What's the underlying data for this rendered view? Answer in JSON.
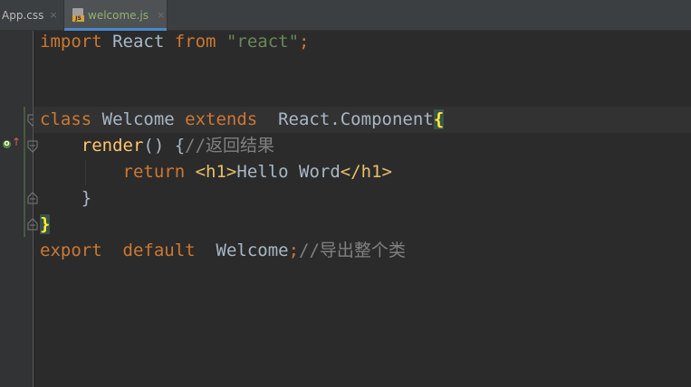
{
  "tabs": [
    {
      "label": "App.css",
      "close": "×"
    },
    {
      "label": "welcome.js",
      "close": "×",
      "icon_text": "JS"
    }
  ],
  "gutter": {
    "override_icon": "override-method-icon",
    "override_glyph": "O",
    "arrow_glyph": "↑"
  },
  "code": {
    "line1": {
      "kw1": "import",
      "name": " React ",
      "kw2": "from",
      "sp": " ",
      "str": "\"react\"",
      "semi": ";"
    },
    "line4": {
      "kw1": "class",
      "name": " Welcome ",
      "kw2": "extends",
      "parent": "  React.Component",
      "brace": "{"
    },
    "line5": {
      "indent": "    ",
      "fn": "render",
      "rest": "() {",
      "comment": "//返回结果"
    },
    "line6": {
      "indent": "        ",
      "kw": "return",
      "sp": " ",
      "t1": "<h1>",
      "text": "Hello Word",
      "t2": "</h1>"
    },
    "line7": {
      "indent": "    ",
      "brace": "}"
    },
    "line8": {
      "brace": "}"
    },
    "line9": {
      "kw1": "export",
      "sp1": "  ",
      "kw2": "default",
      "sp2": "  ",
      "name": "Welcome",
      "semi": ";",
      "comment": "//导出整个类"
    }
  },
  "colors": {
    "background": "#2b2b2b",
    "keyword": "#cc7832",
    "string": "#6a8759",
    "function": "#ffc66d",
    "comment": "#808080",
    "tag": "#e8bf6a",
    "brace_match": "#ffef28"
  }
}
